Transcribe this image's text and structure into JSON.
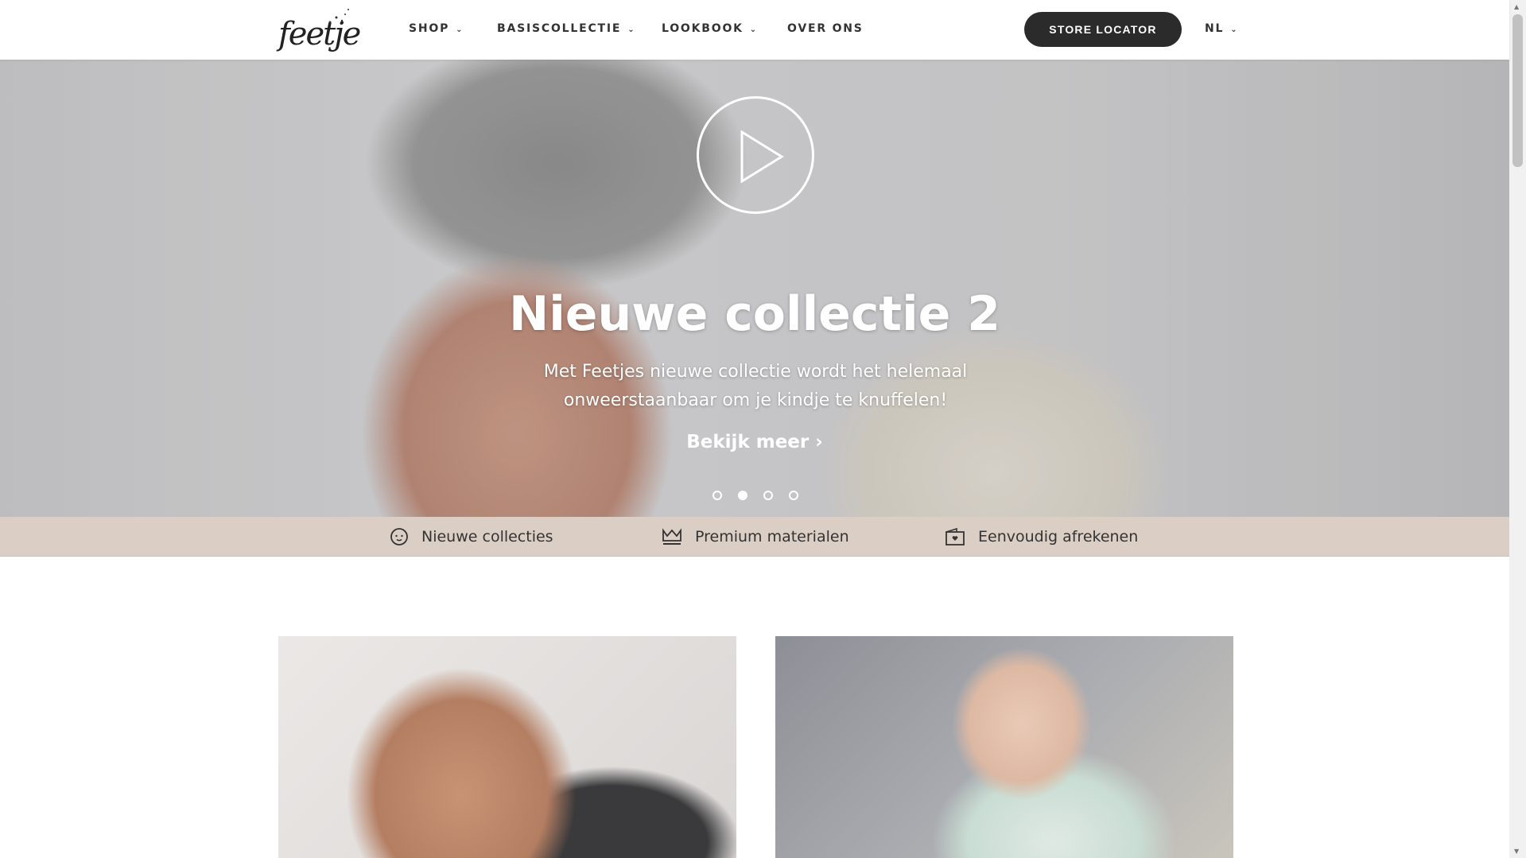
{
  "header": {
    "logo": "feetje",
    "nav": [
      {
        "label": "SHOP",
        "dropdown": true
      },
      {
        "label": "BASISCOLLECTIE",
        "dropdown": true
      },
      {
        "label": "LOOKBOOK",
        "dropdown": true
      },
      {
        "label": "OVER ONS",
        "dropdown": false
      }
    ],
    "store_locator": "STORE LOCATOR",
    "language": "NL"
  },
  "hero": {
    "title": "Nieuwe collectie 2",
    "subtitle": "Met Feetjes nieuwe collectie wordt het helemaal onweerstaanbaar om je kindje te knuffelen!",
    "link": "Bekijk meer ›",
    "slides": 4,
    "active_slide": 2
  },
  "features": [
    {
      "icon": "baby-face-icon",
      "label": "Nieuwe collecties"
    },
    {
      "icon": "crown-icon",
      "label": "Premium materialen"
    },
    {
      "icon": "card-heart-icon",
      "label": "Eenvoudig afrekenen"
    }
  ]
}
